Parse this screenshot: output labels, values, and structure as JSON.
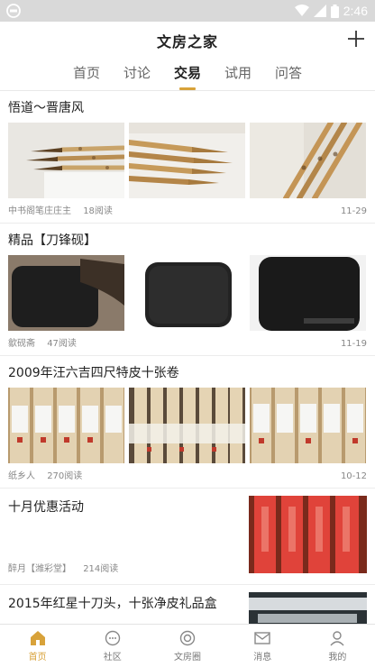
{
  "status": {
    "time": "2:46"
  },
  "header": {
    "title": "文房之家"
  },
  "tabs": [
    {
      "label": "首页"
    },
    {
      "label": "讨论"
    },
    {
      "label": "交易"
    },
    {
      "label": "试用"
    },
    {
      "label": "问答"
    }
  ],
  "active_tab": "交易",
  "posts": [
    {
      "title": "悟道～晋唐风",
      "author": "中书阁笔庄庄主",
      "reads": "18阅读",
      "date": "11-29"
    },
    {
      "title": "精品【刀锋砚】",
      "author": "歙砚斋",
      "reads": "47阅读",
      "date": "11-19"
    },
    {
      "title": "2009年汪六吉四尺特皮十张卷",
      "author": "纸乡人",
      "reads": "270阅读",
      "date": "10-12"
    },
    {
      "title": "十月优惠活动",
      "author": "醉月【潍彩堂】",
      "reads": "214阅读"
    },
    {
      "title": "2015年红星十刀头，十张净皮礼品盒"
    }
  ],
  "bottom_nav": [
    {
      "label": "首页",
      "icon": "home-icon"
    },
    {
      "label": "社区",
      "icon": "chat-icon"
    },
    {
      "label": "文房圈",
      "icon": "circle-icon"
    },
    {
      "label": "消息",
      "icon": "mail-icon"
    },
    {
      "label": "我的",
      "icon": "user-icon"
    }
  ],
  "colors": {
    "accent": "#d8a23a",
    "status_bar": "#d9d9d9"
  }
}
